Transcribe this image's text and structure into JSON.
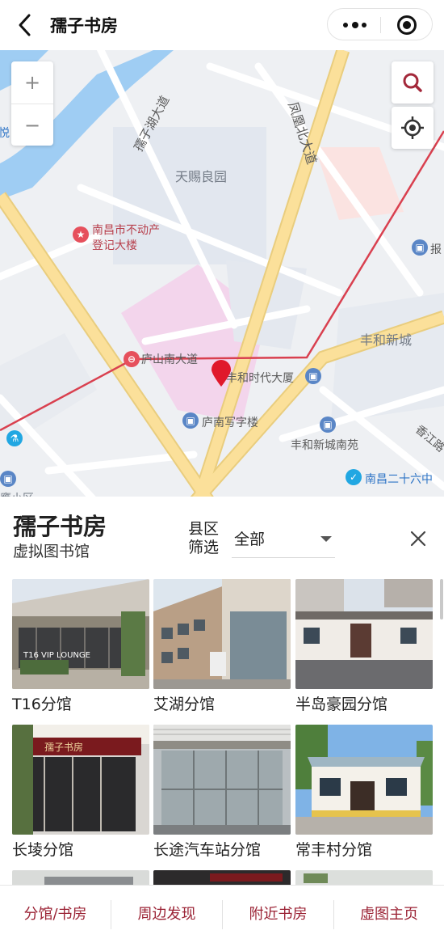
{
  "header": {
    "title": "孺子书房",
    "back_icon": "chevron-left-icon",
    "more_icon": "more-dots-icon",
    "close_icon": "target-close-icon"
  },
  "map": {
    "labels": {
      "ruizihu": "孺子湖大道",
      "fenghuang": "凤凰北大道",
      "tianci": "天赐良园",
      "budongchan_1": "南昌市不动产",
      "budongchan_2": "登记大楼",
      "lushan": "庐山南大道",
      "shidai": "丰和时代大厦",
      "xiezilou": "庐南写字楼",
      "xincheng": "丰和新城",
      "nanyuan": "丰和新城南苑",
      "xiangjiang": "香江路",
      "school": "南昌二十六中",
      "bao": "报",
      "edge_left": "悦",
      "edge_bottom": "鹰小区"
    },
    "controls": {
      "zoom_in": "+",
      "zoom_out": "−",
      "search_icon": "search-icon",
      "locate_icon": "locate-icon"
    },
    "colors": {
      "marker": "#e0182b",
      "metro_line": "#d9404f",
      "water": "#9fcdf3",
      "road_major": "#f9dc8c"
    }
  },
  "info": {
    "title": "孺子书房",
    "subtitle": "虚拟图书馆",
    "filter_label": "县区筛选",
    "district_selected": "全部",
    "close_icon": "close-icon"
  },
  "branches": [
    {
      "name": "T16分馆"
    },
    {
      "name": "艾湖分馆"
    },
    {
      "name": "半岛豪园分馆"
    },
    {
      "name": "长堎分馆"
    },
    {
      "name": "长途汽车站分馆"
    },
    {
      "name": "常丰村分馆"
    }
  ],
  "photo_signs": {
    "lounge": "T16 VIP LOUNGE",
    "shop": "孺子书房"
  },
  "bottom_nav": [
    {
      "label": "分馆/书房"
    },
    {
      "label": "周边发现"
    },
    {
      "label": "附近书房"
    },
    {
      "label": "虚图主页"
    }
  ],
  "colors": {
    "accent": "#9b2335"
  }
}
